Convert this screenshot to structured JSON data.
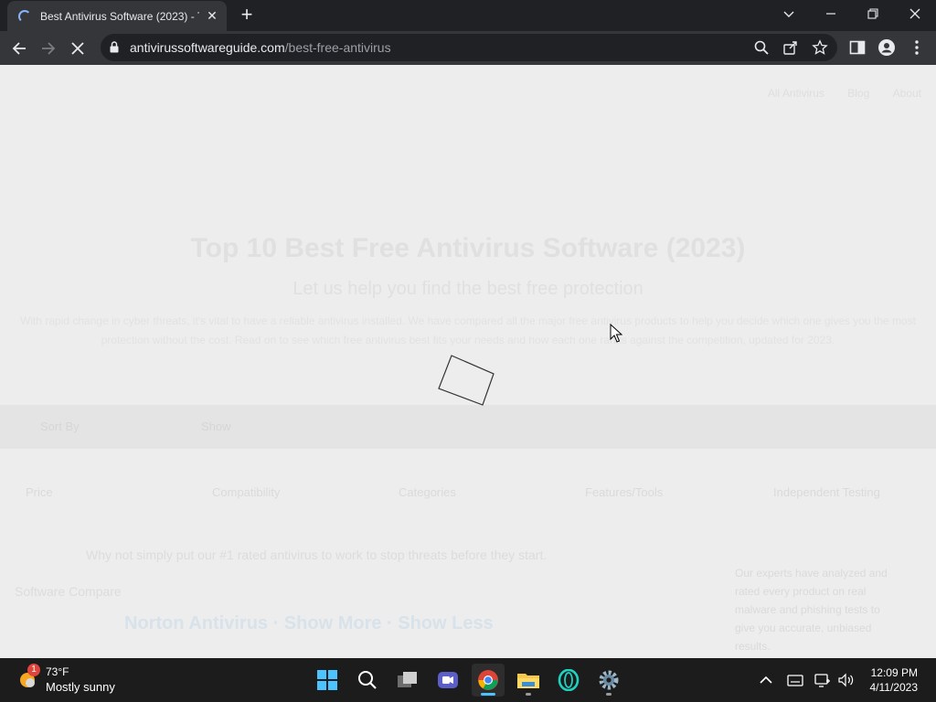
{
  "browser": {
    "tab": {
      "title": "Best Antivirus Software (2023) - T",
      "close": "✕"
    },
    "new_tab": "+",
    "window": {
      "minimize": "—",
      "restore": "❐",
      "close": "✕",
      "tab_search": "⌄"
    },
    "url": {
      "domain": "antivirussoftwareguide.com",
      "path": "/best-free-antivirus"
    }
  },
  "page": {
    "nav": [
      "All Antivirus",
      "Blog",
      "About"
    ],
    "hero_title": "Top 10 Best Free Antivirus Software (2023)",
    "hero_subtitle": "Let us help you find the best free protection",
    "hero_paragraph": "With rapid change in cyber threats, it's vital to have a reliable antivirus installed. We have compared all the major free antivirus products to help you decide which one gives you the most protection without the cost. Read on to see which free antivirus best fits your needs and how each one ranks against the competition, updated for 2023.",
    "band": [
      "Sort By",
      "Show"
    ],
    "filters": [
      "Price",
      "Compatibility",
      "Categories",
      "Features/Tools",
      "Independent Testing"
    ],
    "info_line": "Why not simply put our #1 rated antivirus to work to stop threats before they start.",
    "compare": "Software Compare",
    "big_line": "Norton Antivirus · Show More · Show Less",
    "side_note": "Our experts have analyzed and rated every product on real malware and phishing tests to give you accurate, unbiased results."
  },
  "taskbar": {
    "weather": {
      "temp": "73°F",
      "condition": "Mostly sunny",
      "badge": "1"
    },
    "clock": {
      "time": "12:09 PM",
      "date": "4/11/2023"
    }
  }
}
